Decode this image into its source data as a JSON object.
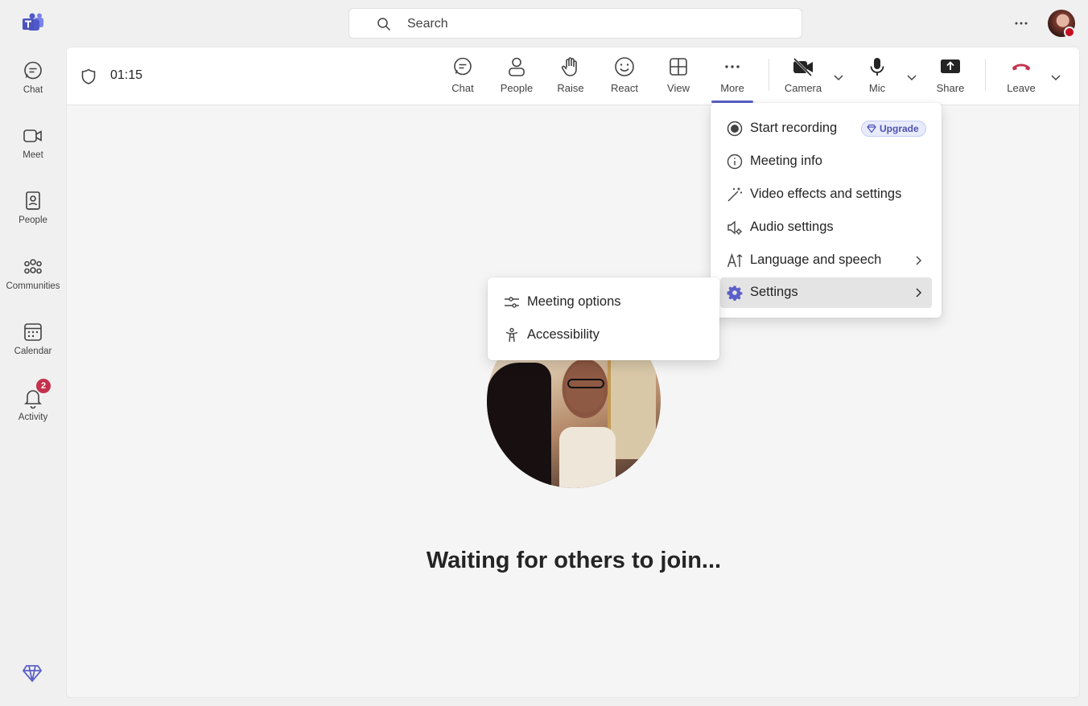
{
  "rail": {
    "items": [
      {
        "label": "Chat"
      },
      {
        "label": "Meet"
      },
      {
        "label": "People"
      },
      {
        "label": "Communities"
      },
      {
        "label": "Calendar"
      },
      {
        "label": "Activity",
        "badge": "2"
      }
    ]
  },
  "search": {
    "placeholder": "Search"
  },
  "meeting": {
    "timer": "01:15",
    "toolbar": {
      "chat": "Chat",
      "people": "People",
      "raise": "Raise",
      "react": "React",
      "view": "View",
      "more": "More",
      "camera": "Camera",
      "mic": "Mic",
      "share": "Share",
      "leave": "Leave"
    },
    "waiting_text": "Waiting for others to join..."
  },
  "more_menu": {
    "items": [
      {
        "label": "Start recording",
        "badge": "Upgrade"
      },
      {
        "label": "Meeting info"
      },
      {
        "label": "Video effects and settings"
      },
      {
        "label": "Audio settings"
      },
      {
        "label": "Language and speech"
      },
      {
        "label": "Settings"
      }
    ]
  },
  "settings_submenu": {
    "items": [
      {
        "label": "Meeting options"
      },
      {
        "label": "Accessibility"
      }
    ]
  },
  "colors": {
    "brand": "#5b5fc7",
    "leave_red": "#c4314b",
    "badge_red": "#c4314b"
  }
}
